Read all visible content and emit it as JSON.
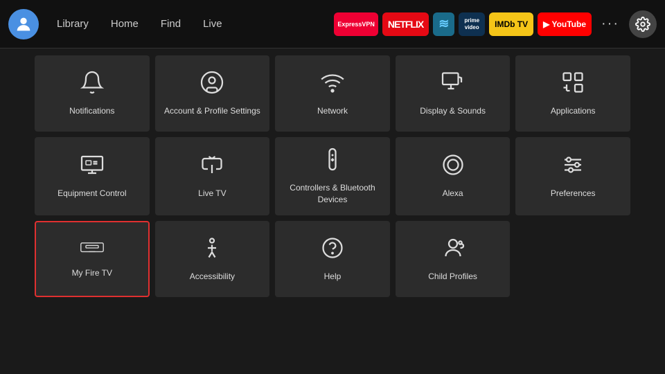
{
  "nav": {
    "avatar_label": "User Avatar",
    "links": [
      "Library",
      "Home",
      "Find",
      "Live"
    ],
    "apps": [
      {
        "label": "ExpressVPN",
        "class": "app-expressvpn"
      },
      {
        "label": "NETFLIX",
        "class": "app-netflix"
      },
      {
        "label": "≋",
        "class": "app-freevee"
      },
      {
        "label": "prime video",
        "class": "app-primevideo"
      },
      {
        "label": "IMDb TV",
        "class": "app-imdb"
      },
      {
        "label": "▶ YouTube",
        "class": "app-youtube"
      }
    ],
    "more_label": "···",
    "settings_label": "⚙"
  },
  "grid": {
    "items": [
      {
        "id": "notifications",
        "label": "Notifications",
        "icon": "bell"
      },
      {
        "id": "account-profile",
        "label": "Account & Profile Settings",
        "icon": "user-circle"
      },
      {
        "id": "network",
        "label": "Network",
        "icon": "wifi"
      },
      {
        "id": "display-sounds",
        "label": "Display & Sounds",
        "icon": "monitor-sound"
      },
      {
        "id": "applications",
        "label": "Applications",
        "icon": "apps"
      },
      {
        "id": "equipment-control",
        "label": "Equipment Control",
        "icon": "monitor-desk"
      },
      {
        "id": "live-tv",
        "label": "Live TV",
        "icon": "antenna"
      },
      {
        "id": "controllers-bluetooth",
        "label": "Controllers & Bluetooth Devices",
        "icon": "remote"
      },
      {
        "id": "alexa",
        "label": "Alexa",
        "icon": "alexa"
      },
      {
        "id": "preferences",
        "label": "Preferences",
        "icon": "sliders"
      },
      {
        "id": "my-fire-tv",
        "label": "My Fire TV",
        "icon": "fire-tv",
        "selected": true
      },
      {
        "id": "accessibility",
        "label": "Accessibility",
        "icon": "person-accessible"
      },
      {
        "id": "help",
        "label": "Help",
        "icon": "question"
      },
      {
        "id": "child-profiles",
        "label": "Child Profiles",
        "icon": "child-profile"
      }
    ]
  }
}
